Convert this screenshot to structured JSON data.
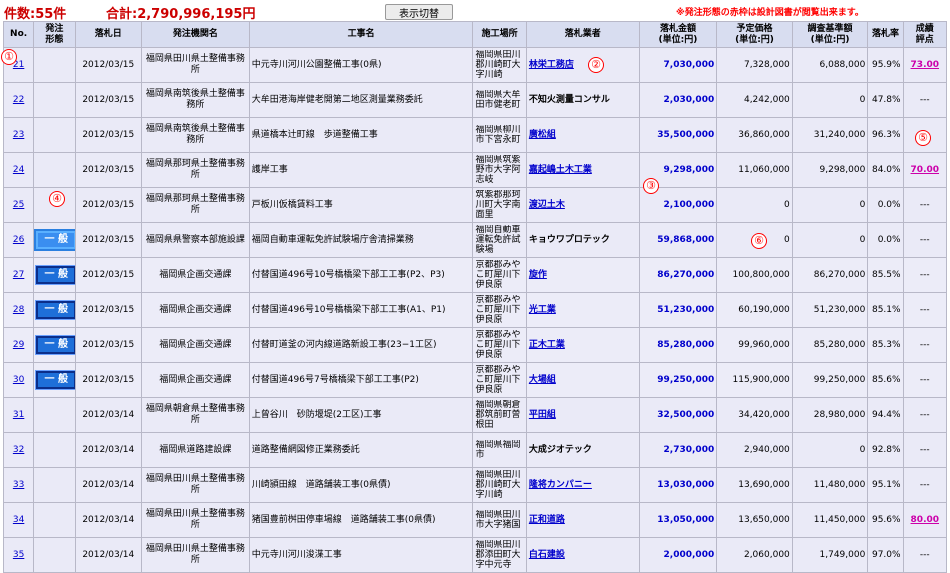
{
  "header": {
    "count": "件数:55件",
    "total": "合計:2,790,996,195円",
    "toggle_button": "表示切替",
    "notice": "※発注形態の赤枠は設計図書が閲覧出来ます。"
  },
  "columns": [
    "No.",
    "発注\n形態",
    "落札日",
    "発注機関名",
    "工事名",
    "施工場所",
    "落札業者",
    "落札金額\n(単位:円)",
    "予定価格\n(単位:円)",
    "調査基準額\n(単位:円)",
    "落札率",
    "成績\n評点"
  ],
  "rows": [
    {
      "no": "21",
      "type": "",
      "date": "2012/03/15",
      "agency": "福岡県田川県土整備事務所",
      "name": "中元寺川河川公園整備工事(0県)",
      "location": "福岡県田川郡川崎町大字川崎",
      "contractor": "林栄工務店",
      "contractor_link": true,
      "amount": "7,030,000",
      "estimate": "7,328,000",
      "base": "6,088,000",
      "rate": "95.9%",
      "evaluation": "73.00"
    },
    {
      "no": "22",
      "type": "",
      "date": "2012/03/15",
      "agency": "福岡県南筑後県土整備事務所",
      "name": "大牟田港海岸健老開第二地区測量業務委託",
      "location": "福岡県大牟田市健老町",
      "contractor": "不知火測量コンサル",
      "contractor_link": false,
      "amount": "2,030,000",
      "estimate": "4,242,000",
      "base": "0",
      "rate": "47.8%",
      "evaluation": "---"
    },
    {
      "no": "23",
      "type": "",
      "date": "2012/03/15",
      "agency": "福岡県南筑後県土整備事務所",
      "name": "県道橋本辻町線　歩道整備工事",
      "location": "福岡県柳川市下宮永町",
      "contractor": "廣松組",
      "contractor_link": true,
      "amount": "35,500,000",
      "estimate": "36,860,000",
      "base": "31,240,000",
      "rate": "96.3%",
      "evaluation": "---"
    },
    {
      "no": "24",
      "type": "",
      "date": "2012/03/15",
      "agency": "福岡県那珂県土整備事務所",
      "name": "護岸工事",
      "location": "福岡県筑紫野市大字阿志岐",
      "contractor": "嘉起嶋土木工業",
      "contractor_link": true,
      "amount": "9,298,000",
      "estimate": "11,060,000",
      "base": "9,298,000",
      "rate": "84.0%",
      "evaluation": "70.00"
    },
    {
      "no": "25",
      "type": "",
      "date": "2012/03/15",
      "agency": "福岡県那珂県土整備事務所",
      "name": "戸板川仮橋賃料工事",
      "location": "筑紫郡那珂川町大字南面里",
      "contractor": "渡辺土木",
      "contractor_link": true,
      "amount": "2,100,000",
      "estimate": "0",
      "base": "0",
      "rate": "0.0%",
      "evaluation": "---"
    },
    {
      "no": "26",
      "type": "一 般",
      "date": "2012/03/15",
      "agency": "福岡県県警察本部施設課",
      "name": "福岡自動車運転免許試験場庁舎清掃業務",
      "location": "福岡自動車運転免許試験場",
      "contractor": "キョウワプロテック",
      "contractor_link": false,
      "amount": "59,868,000",
      "estimate": "0",
      "base": "0",
      "rate": "0.0%",
      "evaluation": "---"
    },
    {
      "no": "27",
      "type": "一 般",
      "date": "2012/03/15",
      "agency": "福岡県企画交通課",
      "name": "付替国道496号10号橋橋梁下部工工事(P2、P3)",
      "location": "京都郡みやこ町犀川下伊良原",
      "contractor": "旋作",
      "contractor_link": true,
      "amount": "86,270,000",
      "estimate": "100,800,000",
      "base": "86,270,000",
      "rate": "85.5%",
      "evaluation": "---"
    },
    {
      "no": "28",
      "type": "一 般",
      "date": "2012/03/15",
      "agency": "福岡県企画交通課",
      "name": "付替国道496号10号橋橋梁下部工工事(A1、P1)",
      "location": "京都郡みやこ町犀川下伊良原",
      "contractor": "光工業",
      "contractor_link": true,
      "amount": "51,230,000",
      "estimate": "60,190,000",
      "base": "51,230,000",
      "rate": "85.1%",
      "evaluation": "---"
    },
    {
      "no": "29",
      "type": "一 般",
      "date": "2012/03/15",
      "agency": "福岡県企画交通課",
      "name": "付替町道釜の河内線道路新設工事(23−1工区)",
      "location": "京都郡みやこ町犀川下伊良原",
      "contractor": "正木工業",
      "contractor_link": true,
      "amount": "85,280,000",
      "estimate": "99,960,000",
      "base": "85,280,000",
      "rate": "85.3%",
      "evaluation": "---"
    },
    {
      "no": "30",
      "type": "一 般",
      "date": "2012/03/15",
      "agency": "福岡県企画交通課",
      "name": "付替国道496号7号橋橋梁下部工工事(P2)",
      "location": "京都郡みやこ町犀川下伊良原",
      "contractor": "大場組",
      "contractor_link": true,
      "amount": "99,250,000",
      "estimate": "115,900,000",
      "base": "99,250,000",
      "rate": "85.6%",
      "evaluation": "---"
    },
    {
      "no": "31",
      "type": "",
      "date": "2012/03/14",
      "agency": "福岡県朝倉県土整備事務所",
      "name": "上曾谷川　砂防堰堤(2工区)工事",
      "location": "福岡県朝倉郡筑前町曽根田",
      "contractor": "平田組",
      "contractor_link": true,
      "amount": "32,500,000",
      "estimate": "34,420,000",
      "base": "28,980,000",
      "rate": "94.4%",
      "evaluation": "---"
    },
    {
      "no": "32",
      "type": "",
      "date": "2012/03/14",
      "agency": "福岡県道路建設課",
      "name": "道路整備網図修正業務委託",
      "location": "福岡県福岡市",
      "contractor": "大成ジオテック",
      "contractor_link": false,
      "amount": "2,730,000",
      "estimate": "2,940,000",
      "base": "0",
      "rate": "92.8%",
      "evaluation": "---"
    },
    {
      "no": "33",
      "type": "",
      "date": "2012/03/14",
      "agency": "福岡県田川県土整備事務所",
      "name": "川崎頴田線　道路舗装工事(0県債)",
      "location": "福岡県田川郡川崎町大字川崎",
      "contractor": "隆将カンパニー",
      "contractor_link": true,
      "amount": "13,030,000",
      "estimate": "13,690,000",
      "base": "11,480,000",
      "rate": "95.1%",
      "evaluation": "---"
    },
    {
      "no": "34",
      "type": "",
      "date": "2012/03/14",
      "agency": "福岡県田川県土整備事務所",
      "name": "猪国豊前桝田停車場線　道路舗装工事(0県債)",
      "location": "福岡県田川市大字猪国",
      "contractor": "正和道路",
      "contractor_link": true,
      "amount": "13,050,000",
      "estimate": "13,650,000",
      "base": "11,450,000",
      "rate": "95.6%",
      "evaluation": "80.00"
    },
    {
      "no": "35",
      "type": "",
      "date": "2012/03/14",
      "agency": "福岡県田川県土整備事務所",
      "name": "中元寺川河川浚渫工事",
      "location": "福岡県田川郡添田町大字中元寺",
      "contractor": "白石建設",
      "contractor_link": true,
      "amount": "2,000,000",
      "estimate": "2,060,000",
      "base": "1,749,000",
      "rate": "97.0%",
      "evaluation": "---"
    }
  ],
  "markers": [
    "①",
    "②",
    "③",
    "④",
    "⑤",
    "⑥"
  ],
  "colors": {
    "header_bg": "#d8ddf0",
    "row_bg": "#eaeaf7",
    "link": "#0000cc",
    "alert": "#ff0000",
    "badge": "#1e6fd9",
    "evaluation_link": "#cc00aa"
  }
}
